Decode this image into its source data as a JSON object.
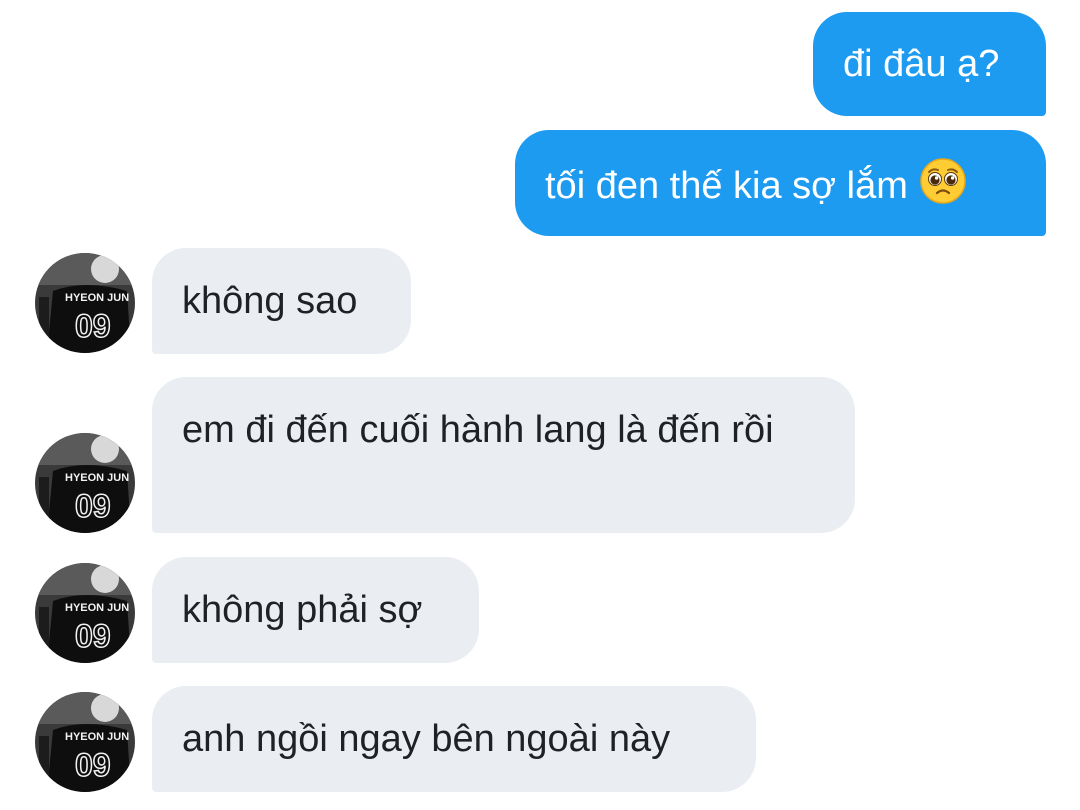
{
  "conversation": {
    "sent": [
      {
        "text": "đi đâu ạ?"
      },
      {
        "text": "tối đen thế kia sợ lắm",
        "emoji": "pleading-face"
      }
    ],
    "received": [
      {
        "text": "không sao"
      },
      {
        "text": "em đi đến cuối hành lang là đến rồi"
      },
      {
        "text": "không phải sợ"
      },
      {
        "text": "anh ngồi ngay bên ngoài này"
      }
    ]
  },
  "avatar": {
    "jersey_name": "HYEON JUN",
    "jersey_number": "09"
  },
  "colors": {
    "sent_bubble": "#1d9bf0",
    "received_bubble": "#eaeef2",
    "received_text": "#1e2226",
    "background": "#ffffff"
  }
}
